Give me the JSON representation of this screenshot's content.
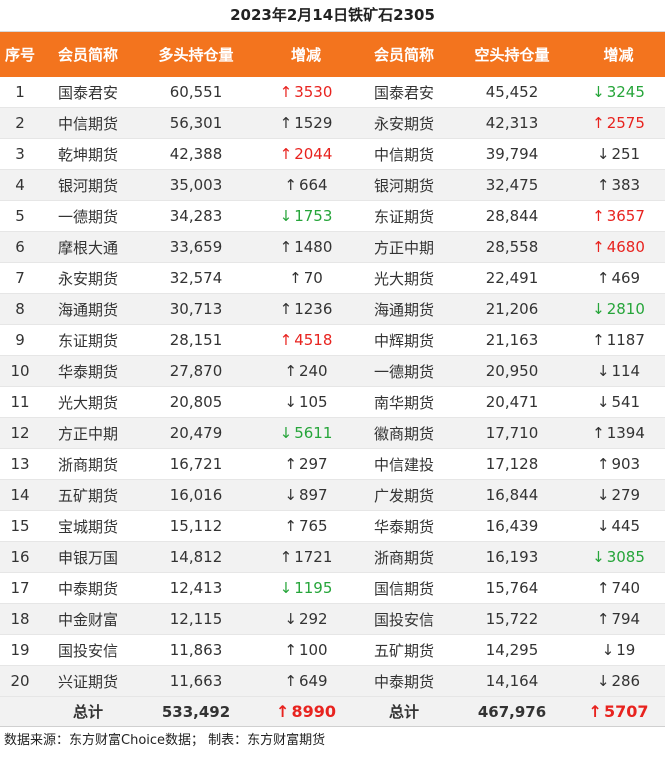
{
  "title": "2023年2月14日铁矿石2305",
  "headers": [
    "序号",
    "会员简称",
    "多头持仓量",
    "增减",
    "会员简称",
    "空头持仓量",
    "增减"
  ],
  "colors": {
    "header_bg": "#f3741e",
    "up_arrow": "#e8231f",
    "down_arrow": "#26a53a"
  },
  "icons": {
    "up": "arrow-up-icon",
    "down": "arrow-down-icon"
  },
  "rows": [
    {
      "rank": "1",
      "long_member": "国泰君安",
      "long_pos": "60,551",
      "long_dir": "up",
      "long_chg": "3530",
      "long_color": "red",
      "short_member": "国泰君安",
      "short_pos": "45,452",
      "short_dir": "down",
      "short_chg": "3245",
      "short_color": "green"
    },
    {
      "rank": "2",
      "long_member": "中信期货",
      "long_pos": "56,301",
      "long_dir": "up",
      "long_chg": "1529",
      "long_color": "black",
      "short_member": "永安期货",
      "short_pos": "42,313",
      "short_dir": "up",
      "short_chg": "2575",
      "short_color": "red"
    },
    {
      "rank": "3",
      "long_member": "乾坤期货",
      "long_pos": "42,388",
      "long_dir": "up",
      "long_chg": "2044",
      "long_color": "red",
      "short_member": "中信期货",
      "short_pos": "39,794",
      "short_dir": "down",
      "short_chg": "251",
      "short_color": "black"
    },
    {
      "rank": "4",
      "long_member": "银河期货",
      "long_pos": "35,003",
      "long_dir": "up",
      "long_chg": "664",
      "long_color": "black",
      "short_member": "银河期货",
      "short_pos": "32,475",
      "short_dir": "up",
      "short_chg": "383",
      "short_color": "black"
    },
    {
      "rank": "5",
      "long_member": "一德期货",
      "long_pos": "34,283",
      "long_dir": "down",
      "long_chg": "1753",
      "long_color": "green",
      "short_member": "东证期货",
      "short_pos": "28,844",
      "short_dir": "up",
      "short_chg": "3657",
      "short_color": "red"
    },
    {
      "rank": "6",
      "long_member": "摩根大通",
      "long_pos": "33,659",
      "long_dir": "up",
      "long_chg": "1480",
      "long_color": "black",
      "short_member": "方正中期",
      "short_pos": "28,558",
      "short_dir": "up",
      "short_chg": "4680",
      "short_color": "red"
    },
    {
      "rank": "7",
      "long_member": "永安期货",
      "long_pos": "32,574",
      "long_dir": "up",
      "long_chg": "70",
      "long_color": "black",
      "short_member": "光大期货",
      "short_pos": "22,491",
      "short_dir": "up",
      "short_chg": "469",
      "short_color": "black"
    },
    {
      "rank": "8",
      "long_member": "海通期货",
      "long_pos": "30,713",
      "long_dir": "up",
      "long_chg": "1236",
      "long_color": "black",
      "short_member": "海通期货",
      "short_pos": "21,206",
      "short_dir": "down",
      "short_chg": "2810",
      "short_color": "green"
    },
    {
      "rank": "9",
      "long_member": "东证期货",
      "long_pos": "28,151",
      "long_dir": "up",
      "long_chg": "4518",
      "long_color": "red",
      "short_member": "中辉期货",
      "short_pos": "21,163",
      "short_dir": "up",
      "short_chg": "1187",
      "short_color": "black"
    },
    {
      "rank": "10",
      "long_member": "华泰期货",
      "long_pos": "27,870",
      "long_dir": "up",
      "long_chg": "240",
      "long_color": "black",
      "short_member": "一德期货",
      "short_pos": "20,950",
      "short_dir": "down",
      "short_chg": "114",
      "short_color": "black"
    },
    {
      "rank": "11",
      "long_member": "光大期货",
      "long_pos": "20,805",
      "long_dir": "down",
      "long_chg": "105",
      "long_color": "black",
      "short_member": "南华期货",
      "short_pos": "20,471",
      "short_dir": "down",
      "short_chg": "541",
      "short_color": "black"
    },
    {
      "rank": "12",
      "long_member": "方正中期",
      "long_pos": "20,479",
      "long_dir": "down",
      "long_chg": "5611",
      "long_color": "green",
      "short_member": "徽商期货",
      "short_pos": "17,710",
      "short_dir": "up",
      "short_chg": "1394",
      "short_color": "black"
    },
    {
      "rank": "13",
      "long_member": "浙商期货",
      "long_pos": "16,721",
      "long_dir": "up",
      "long_chg": "297",
      "long_color": "black",
      "short_member": "中信建投",
      "short_pos": "17,128",
      "short_dir": "up",
      "short_chg": "903",
      "short_color": "black"
    },
    {
      "rank": "14",
      "long_member": "五矿期货",
      "long_pos": "16,016",
      "long_dir": "down",
      "long_chg": "897",
      "long_color": "black",
      "short_member": "广发期货",
      "short_pos": "16,844",
      "short_dir": "down",
      "short_chg": "279",
      "short_color": "black"
    },
    {
      "rank": "15",
      "long_member": "宝城期货",
      "long_pos": "15,112",
      "long_dir": "up",
      "long_chg": "765",
      "long_color": "black",
      "short_member": "华泰期货",
      "short_pos": "16,439",
      "short_dir": "down",
      "short_chg": "445",
      "short_color": "black"
    },
    {
      "rank": "16",
      "long_member": "申银万国",
      "long_pos": "14,812",
      "long_dir": "up",
      "long_chg": "1721",
      "long_color": "black",
      "short_member": "浙商期货",
      "short_pos": "16,193",
      "short_dir": "down",
      "short_chg": "3085",
      "short_color": "green"
    },
    {
      "rank": "17",
      "long_member": "中泰期货",
      "long_pos": "12,413",
      "long_dir": "down",
      "long_chg": "1195",
      "long_color": "green",
      "short_member": "国信期货",
      "short_pos": "15,764",
      "short_dir": "up",
      "short_chg": "740",
      "short_color": "black"
    },
    {
      "rank": "18",
      "long_member": "中金财富",
      "long_pos": "12,115",
      "long_dir": "down",
      "long_chg": "292",
      "long_color": "black",
      "short_member": "国投安信",
      "short_pos": "15,722",
      "short_dir": "up",
      "short_chg": "794",
      "short_color": "black"
    },
    {
      "rank": "19",
      "long_member": "国投安信",
      "long_pos": "11,863",
      "long_dir": "up",
      "long_chg": "100",
      "long_color": "black",
      "short_member": "五矿期货",
      "short_pos": "14,295",
      "short_dir": "down",
      "short_chg": "19",
      "short_color": "black"
    },
    {
      "rank": "20",
      "long_member": "兴证期货",
      "long_pos": "11,663",
      "long_dir": "up",
      "long_chg": "649",
      "long_color": "black",
      "short_member": "中泰期货",
      "short_pos": "14,164",
      "short_dir": "down",
      "short_chg": "286",
      "short_color": "black"
    }
  ],
  "total": {
    "label": "总计",
    "long_pos": "533,492",
    "long_dir": "up",
    "long_chg": "8990",
    "long_color": "red",
    "short_label": "总计",
    "short_pos": "467,976",
    "short_dir": "up",
    "short_chg": "5707",
    "short_color": "red"
  },
  "footer": "数据来源：东方财富Choice数据； 制表：东方财富期货"
}
